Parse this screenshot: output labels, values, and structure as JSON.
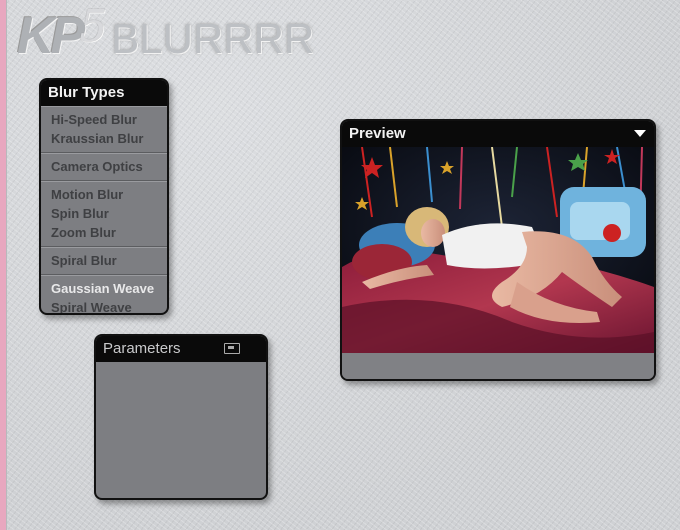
{
  "logo": {
    "prefix": "KP",
    "version": "5",
    "product": "BLURRRR"
  },
  "blur_types": {
    "title": "Blur Types",
    "groups": [
      {
        "items": [
          {
            "label": "Hi-Speed Blur"
          },
          {
            "label": "Kraussian Blur"
          }
        ]
      },
      {
        "items": [
          {
            "label": "Camera Optics"
          }
        ]
      },
      {
        "items": [
          {
            "label": "Motion Blur"
          },
          {
            "label": "Spin Blur"
          },
          {
            "label": "Zoom Blur"
          }
        ]
      },
      {
        "items": [
          {
            "label": "Spiral Blur"
          }
        ]
      },
      {
        "items": [
          {
            "label": "Gaussian Weave"
          },
          {
            "label": "Spiral Weave"
          }
        ]
      }
    ]
  },
  "parameters": {
    "title": "Parameters",
    "icon": "panel-icon"
  },
  "preview": {
    "title": "Preview",
    "menu_icon": "triangle-down-icon",
    "image": "preview-photo-woman-on-bed"
  },
  "colors": {
    "panel_bg": "#7d7e82",
    "title_bar": "#0a0a0a",
    "desktop": "#d3d5d8",
    "accent_pink": "#e8a7bf"
  }
}
